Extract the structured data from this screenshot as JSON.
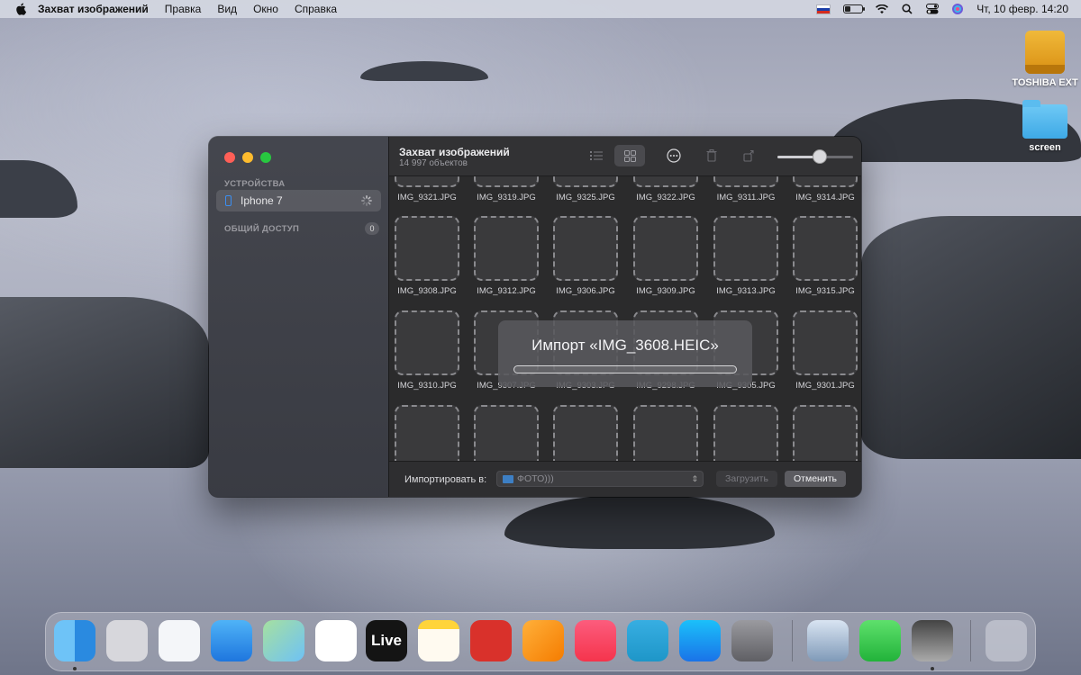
{
  "menubar": {
    "app_name": "Захват изображений",
    "menus": [
      "Правка",
      "Вид",
      "Окно",
      "Справка"
    ],
    "datetime": "Чт, 10 февр.  14:20",
    "battery_level": 0.3
  },
  "desktop": {
    "icons": [
      {
        "label": "TOSHIBA EXT",
        "icon": "external-drive-icon"
      },
      {
        "label": "screen",
        "icon": "folder-icon"
      }
    ]
  },
  "window": {
    "sidebar": {
      "devices_header": "УСТРОЙСТВА",
      "device_name": "Iphone 7",
      "shared_header": "ОБЩИЙ ДОСТУП",
      "shared_count": "0"
    },
    "toolbar": {
      "title": "Захват изображений",
      "subtitle": "14 997 объектов",
      "thumbnail_size": 0.56
    },
    "grid": {
      "top_row": [
        "IMG_9321.JPG",
        "IMG_9319.JPG",
        "IMG_9325.JPG",
        "IMG_9322.JPG",
        "IMG_9311.JPG",
        "IMG_9314.JPG"
      ],
      "row2": [
        "IMG_9308.JPG",
        "IMG_9312.JPG",
        "IMG_9306.JPG",
        "IMG_9309.JPG",
        "IMG_9313.JPG",
        "IMG_9315.JPG"
      ],
      "row3": [
        "IMG_9310.JPG",
        "IMG_9307.JPG",
        "IMG_9303.JPG",
        "IMG_9298.JPG",
        "IMG_9305.JPG",
        "IMG_9301.JPG"
      ]
    },
    "bottom": {
      "import_label": "Импортировать в:",
      "destination": "ФОТО)))",
      "load_button": "Загрузить",
      "cancel_button": "Отменить"
    },
    "progress": {
      "title": "Импорт «IMG_3608.HEIC»",
      "fraction": 0.0
    }
  },
  "dock": {
    "apps": [
      "Finder",
      "Launchpad",
      "Safari",
      "Mail",
      "Maps",
      "Photos",
      "Live",
      "Notes",
      "Photo Booth",
      "Pages",
      "Music",
      "Telegram",
      "App Store",
      "System Preferences",
      "Preview",
      "FaceTime",
      "Image Capture",
      "Trash"
    ],
    "live_label": "Live"
  }
}
